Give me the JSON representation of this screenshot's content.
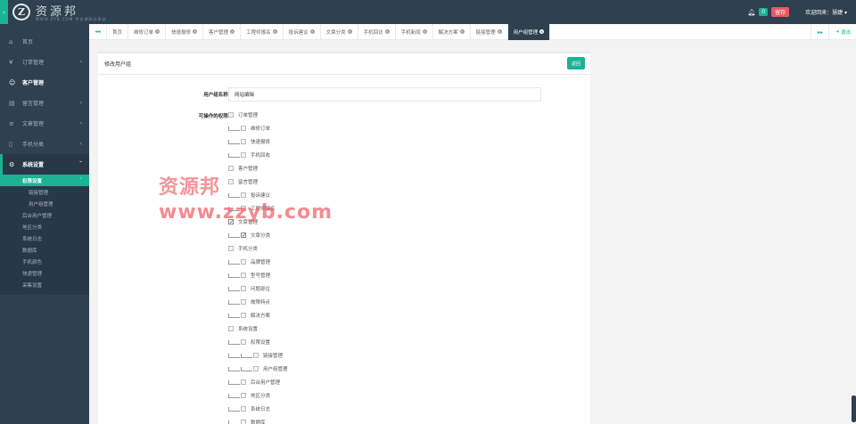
{
  "header": {
    "logo_mark": "Z",
    "logo_name": "资源邦",
    "logo_slogan": "WWW.ZYB.COM 专业源码分享站",
    "notify_count": "0",
    "tag": "留存",
    "welcome": "欢迎回来：慧婕 ▾"
  },
  "sidebar": {
    "items": [
      {
        "icon": "⌂",
        "label": "首页",
        "arrow": ""
      },
      {
        "icon": "¥",
        "label": "订单管理",
        "arrow": "‹"
      },
      {
        "icon": "☺",
        "label": "客户管理",
        "arrow": ""
      },
      {
        "icon": "▤",
        "label": "留言管理",
        "arrow": "‹"
      },
      {
        "icon": "≡",
        "label": "文章管理",
        "arrow": "‹"
      },
      {
        "icon": "▯",
        "label": "手机分类",
        "arrow": "‹"
      },
      {
        "icon": "⚙",
        "label": "系统设置",
        "arrow": "ˇ"
      }
    ],
    "submenu": {
      "active": "权限设置",
      "active_arrow": "ˇ",
      "children": [
        "链接管理",
        "用户组管理"
      ],
      "others": [
        "后台用户管理",
        "地区分类",
        "系统日志",
        "数据库",
        "手机颜色",
        "快递管理",
        "采集设置"
      ]
    }
  },
  "tabbar": {
    "back": "◂◂",
    "forward": "▸▸",
    "logout": "退出",
    "close_glyph": "×",
    "tabs": [
      "首页",
      "维修订单",
      "快速报修",
      "客户管理",
      "工程师报名",
      "投诉建议",
      "文章分类",
      "手机回访",
      "手机新闻",
      "解决方案",
      "链接管理",
      "用户组管理"
    ]
  },
  "panel": {
    "title": "修改用户组",
    "back_label": "返回",
    "name_label": "用户组名称:",
    "name_value": "网站编辑",
    "perm_label": "可操作的权限:"
  },
  "permissions": [
    {
      "label": "订单管理",
      "level": 0,
      "checked": false
    },
    {
      "label": "维修订单",
      "level": 1,
      "checked": false
    },
    {
      "label": "快速报修",
      "level": 1,
      "checked": false
    },
    {
      "label": "手机回收",
      "level": 1,
      "checked": false
    },
    {
      "label": "客户管理",
      "level": 0,
      "checked": false
    },
    {
      "label": "留言管理",
      "level": 0,
      "checked": false
    },
    {
      "label": "投诉建议",
      "level": 1,
      "checked": false
    },
    {
      "label": "工程师报名",
      "level": 1,
      "checked": false
    },
    {
      "label": "文章管理",
      "level": 0,
      "checked": true
    },
    {
      "label": "文章分类",
      "level": 1,
      "checked": true
    },
    {
      "label": "手机分类",
      "level": 0,
      "checked": false
    },
    {
      "label": "品牌管理",
      "level": 1,
      "checked": false
    },
    {
      "label": "型号管理",
      "level": 1,
      "checked": false
    },
    {
      "label": "问题部位",
      "level": 1,
      "checked": false
    },
    {
      "label": "故障特点",
      "level": 1,
      "checked": false
    },
    {
      "label": "解决方案",
      "level": 1,
      "checked": false
    },
    {
      "label": "系统设置",
      "level": 0,
      "checked": false
    },
    {
      "label": "权限设置",
      "level": 1,
      "checked": false
    },
    {
      "label": "链接管理",
      "level": 2,
      "checked": false
    },
    {
      "label": "用户组管理",
      "level": 2,
      "checked": false
    },
    {
      "label": "后台用户管理",
      "level": 1,
      "checked": false
    },
    {
      "label": "地区分类",
      "level": 1,
      "checked": false
    },
    {
      "label": "系统日志",
      "level": 1,
      "checked": false
    },
    {
      "label": "数据库",
      "level": 1,
      "checked": false
    }
  ],
  "watermark": {
    "line1": "资源邦",
    "line2": "www.zzyb.com"
  },
  "colors": {
    "sidebar_bg": "#2f4050",
    "accent": "#1ab394",
    "tag_red": "#ed5565"
  }
}
